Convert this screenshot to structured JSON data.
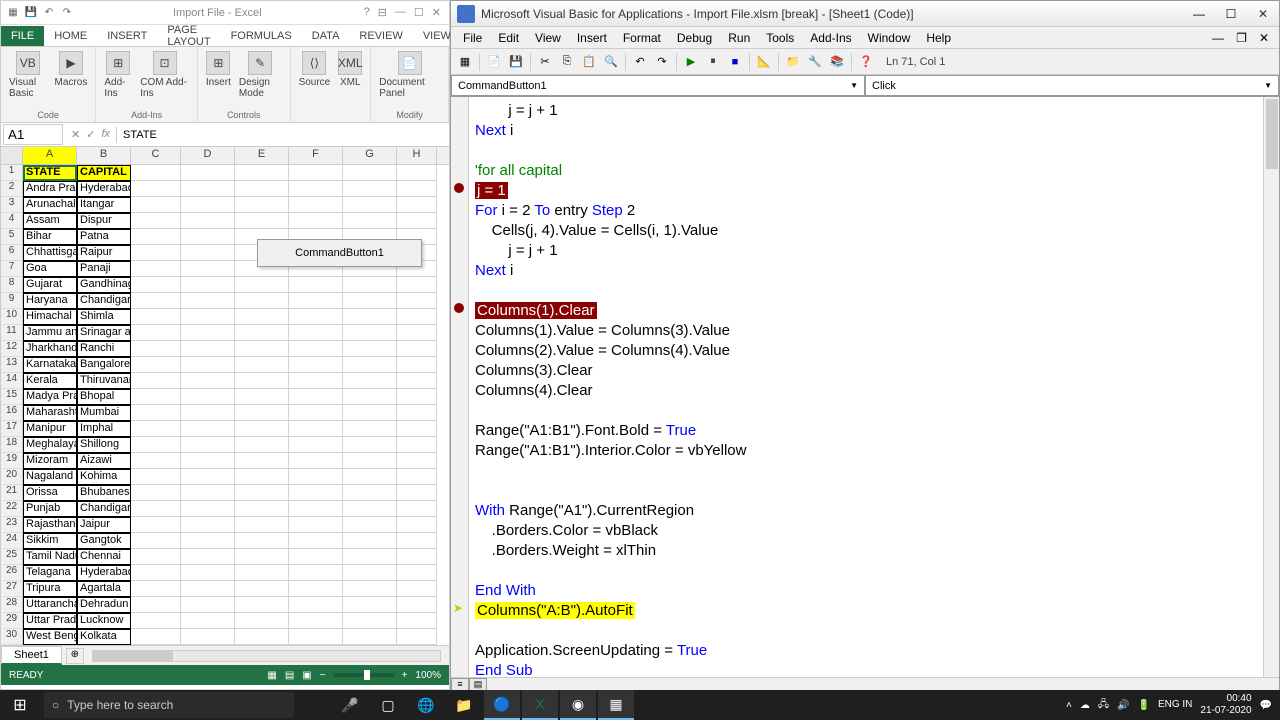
{
  "excel": {
    "title": "Import File - Excel",
    "tabs": [
      "FILE",
      "HOME",
      "INSERT",
      "PAGE LAYOUT",
      "FORMULAS",
      "DATA",
      "REVIEW",
      "VIEW"
    ],
    "ribbon_groups": {
      "code": {
        "label": "Code",
        "items": [
          "Visual\nBasic",
          "Macros"
        ]
      },
      "addins": {
        "label": "Add-Ins",
        "items": [
          "Add-Ins",
          "COM\nAdd-Ins"
        ]
      },
      "controls": {
        "label": "Controls",
        "items": [
          "Insert",
          "Design\nMode"
        ]
      },
      "xml": {
        "label": "",
        "items": [
          "Source",
          "XML"
        ]
      },
      "modify": {
        "label": "Modify",
        "items": [
          "Document\nPanel"
        ]
      }
    },
    "name_box": "A1",
    "formula_value": "STATE",
    "columns": [
      "A",
      "B",
      "C",
      "D",
      "E",
      "F",
      "G",
      "H"
    ],
    "command_button": "CommandButton1",
    "sheet_tab": "Sheet1",
    "status": "READY",
    "zoom": "100%",
    "rows": [
      {
        "n": 1,
        "a": "STATE",
        "b": "CAPITAL",
        "hdr": true
      },
      {
        "n": 2,
        "a": "Andra Pradesh",
        "b": "Hyderabad, Amaravati"
      },
      {
        "n": 3,
        "a": "Arunachal",
        "b": "Itangar"
      },
      {
        "n": 4,
        "a": "Assam",
        "b": "Dispur"
      },
      {
        "n": 5,
        "a": "Bihar",
        "b": "Patna"
      },
      {
        "n": 6,
        "a": "Chhattisgarh",
        "b": "Raipur"
      },
      {
        "n": 7,
        "a": "Goa",
        "b": "Panaji"
      },
      {
        "n": 8,
        "a": "Gujarat",
        "b": "Gandhinagar"
      },
      {
        "n": 9,
        "a": "Haryana",
        "b": "Chandigarh"
      },
      {
        "n": 10,
        "a": "Himachal",
        "b": "Shimla"
      },
      {
        "n": 11,
        "a": "Jammu and",
        "b": "Srinagar and Jammu"
      },
      {
        "n": 12,
        "a": "Jharkhand",
        "b": "Ranchi"
      },
      {
        "n": 13,
        "a": "Karnataka",
        "b": "Bangalore"
      },
      {
        "n": 14,
        "a": "Kerala",
        "b": "Thiruvananthapuram"
      },
      {
        "n": 15,
        "a": "Madya Pradesh",
        "b": "Bhopal"
      },
      {
        "n": 16,
        "a": "Maharashtra",
        "b": "Mumbai"
      },
      {
        "n": 17,
        "a": "Manipur",
        "b": "Imphal"
      },
      {
        "n": 18,
        "a": "Meghalaya",
        "b": "Shillong"
      },
      {
        "n": 19,
        "a": "Mizoram",
        "b": "Aizawi"
      },
      {
        "n": 20,
        "a": "Nagaland",
        "b": "Kohima"
      },
      {
        "n": 21,
        "a": "Orissa",
        "b": "Bhubaneshwar"
      },
      {
        "n": 22,
        "a": "Punjab",
        "b": "Chandigarh"
      },
      {
        "n": 23,
        "a": "Rajasthan",
        "b": "Jaipur"
      },
      {
        "n": 24,
        "a": "Sikkim",
        "b": "Gangtok"
      },
      {
        "n": 25,
        "a": "Tamil Nadu",
        "b": "Chennai"
      },
      {
        "n": 26,
        "a": "Telagana",
        "b": "Hyderabad"
      },
      {
        "n": 27,
        "a": "Tripura",
        "b": "Agartala"
      },
      {
        "n": 28,
        "a": "Uttaranchal",
        "b": "Dehradun"
      },
      {
        "n": 29,
        "a": "Uttar Pradesh",
        "b": "Lucknow"
      },
      {
        "n": 30,
        "a": "West Bengal",
        "b": "Kolkata"
      }
    ]
  },
  "vba": {
    "title": "Microsoft Visual Basic for Applications - Import File.xlsm [break] - [Sheet1 (Code)]",
    "menus": [
      "File",
      "Edit",
      "View",
      "Insert",
      "Format",
      "Debug",
      "Run",
      "Tools",
      "Add-Ins",
      "Window",
      "Help"
    ],
    "position": "Ln 71, Col 1",
    "dd_left": "CommandButton1",
    "dd_right": "Click",
    "code": [
      {
        "t": "        j = j + 1",
        "type": "plain"
      },
      {
        "t": "Next i",
        "type": "kw-line",
        "kw": [
          "Next"
        ]
      },
      {
        "t": "",
        "type": "blank"
      },
      {
        "t": "'for all capital",
        "type": "comment"
      },
      {
        "t": "j = 1",
        "type": "break"
      },
      {
        "t": "For i = 2 To entry Step 2",
        "type": "kw-line",
        "kw": [
          "For",
          "To",
          "Step"
        ]
      },
      {
        "t": "    Cells(j, 4).Value = Cells(i, 1).Value",
        "type": "plain"
      },
      {
        "t": "        j = j + 1",
        "type": "plain"
      },
      {
        "t": "Next i",
        "type": "kw-line",
        "kw": [
          "Next"
        ]
      },
      {
        "t": "",
        "type": "blank"
      },
      {
        "t": "Columns(1).Clear",
        "type": "break"
      },
      {
        "t": "Columns(1).Value = Columns(3).Value",
        "type": "plain"
      },
      {
        "t": "Columns(2).Value = Columns(4).Value",
        "type": "plain"
      },
      {
        "t": "Columns(3).Clear",
        "type": "plain"
      },
      {
        "t": "Columns(4).Clear",
        "type": "plain"
      },
      {
        "t": "",
        "type": "blank"
      },
      {
        "t": "Range(\"A1:B1\").Font.Bold = True",
        "type": "kw-line",
        "kw": [
          "True"
        ]
      },
      {
        "t": "Range(\"A1:B1\").Interior.Color = vbYellow",
        "type": "plain"
      },
      {
        "t": "",
        "type": "blank"
      },
      {
        "t": "",
        "type": "blank"
      },
      {
        "t": "With Range(\"A1\").CurrentRegion",
        "type": "kw-line",
        "kw": [
          "With"
        ]
      },
      {
        "t": "    .Borders.Color = vbBlack",
        "type": "plain"
      },
      {
        "t": "    .Borders.Weight = xlThin",
        "type": "plain"
      },
      {
        "t": "",
        "type": "blank"
      },
      {
        "t": "End With",
        "type": "kw-line",
        "kw": [
          "End",
          "With"
        ]
      },
      {
        "t": "Columns(\"A:B\").AutoFit",
        "type": "exec"
      },
      {
        "t": "",
        "type": "blank"
      },
      {
        "t": "Application.ScreenUpdating = True",
        "type": "kw-line",
        "kw": [
          "True"
        ]
      },
      {
        "t": "End Sub",
        "type": "kw-line",
        "kw": [
          "End",
          "Sub"
        ]
      }
    ]
  },
  "taskbar": {
    "search_placeholder": "Type here to search",
    "lang": "ENG\nIN",
    "time": "00:40",
    "date": "21-07-2020"
  }
}
